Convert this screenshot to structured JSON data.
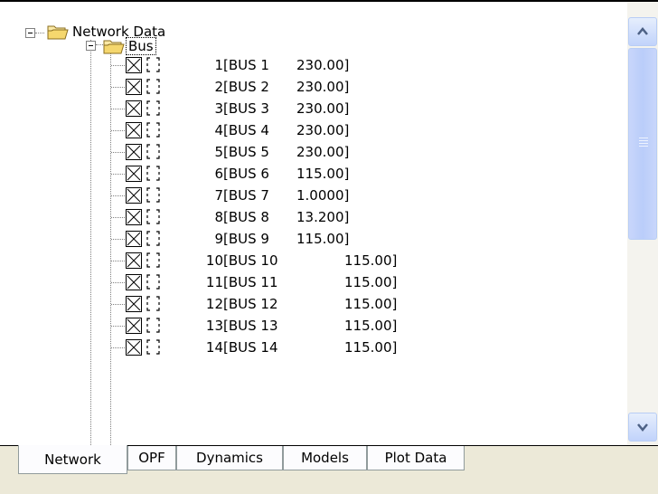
{
  "tree": {
    "root_label": "Network Data",
    "bus_folder_label": "Bus",
    "buses": [
      {
        "num": "1",
        "name": "[BUS 1",
        "voltage": "230.00]"
      },
      {
        "num": "2",
        "name": "[BUS 2",
        "voltage": "230.00]"
      },
      {
        "num": "3",
        "name": "[BUS 3",
        "voltage": "230.00]"
      },
      {
        "num": "4",
        "name": "[BUS 4",
        "voltage": "230.00]"
      },
      {
        "num": "5",
        "name": "[BUS 5",
        "voltage": "230.00]"
      },
      {
        "num": "6",
        "name": "[BUS 6",
        "voltage": "115.00]"
      },
      {
        "num": "7",
        "name": "[BUS 7",
        "voltage": "1.0000]"
      },
      {
        "num": "8",
        "name": "[BUS 8",
        "voltage": "13.200]"
      },
      {
        "num": "9",
        "name": "[BUS 9",
        "voltage": "115.00]"
      },
      {
        "num": "10",
        "name": "[BUS 10",
        "voltage": "115.00]"
      },
      {
        "num": "11",
        "name": "[BUS 11",
        "voltage": "115.00]"
      },
      {
        "num": "12",
        "name": "[BUS 12",
        "voltage": "115.00]"
      },
      {
        "num": "13",
        "name": "[BUS 13",
        "voltage": "115.00]"
      },
      {
        "num": "14",
        "name": "[BUS 14",
        "voltage": "115.00]"
      }
    ]
  },
  "tabs": [
    {
      "label": "Network",
      "active": true
    },
    {
      "label": "OPF",
      "active": false
    },
    {
      "label": "Dynamics",
      "active": false
    },
    {
      "label": "Models",
      "active": false
    },
    {
      "label": "Plot Data",
      "active": false
    }
  ],
  "colors": {
    "folder": "#f5d76e",
    "scrollbar_accent": "#c1d3fb",
    "arrow": "#4d6185"
  },
  "icons": {
    "expand": "collapse-minus-icon",
    "folder": "open-folder-icon",
    "checkbox": "checkbox-crossed-icon",
    "bracket": "dashed-bracket-icon",
    "scroll_up": "arrow-up-icon",
    "scroll_down": "arrow-down-icon"
  }
}
